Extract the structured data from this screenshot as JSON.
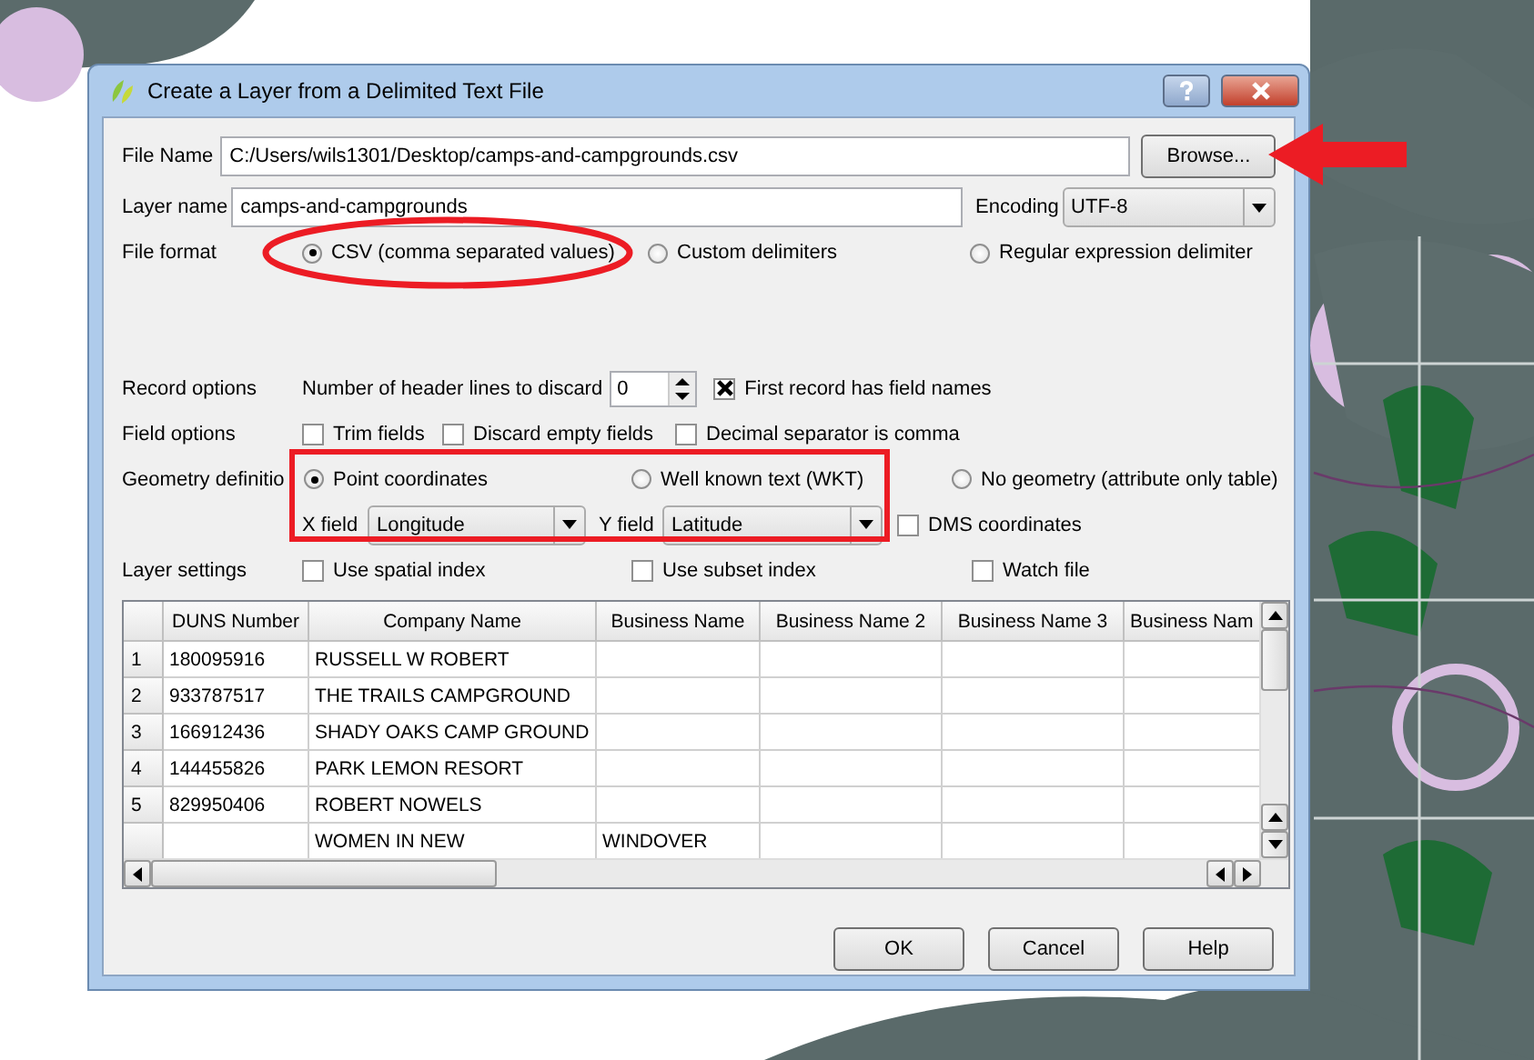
{
  "window": {
    "title": "Create a Layer from a Delimited Text File"
  },
  "file_name": {
    "label": "File Name",
    "value": "C:/Users/wils1301/Desktop/camps-and-campgrounds.csv",
    "button": "Browse..."
  },
  "layer_name": {
    "label": "Layer name",
    "value": "camps-and-campgrounds"
  },
  "encoding": {
    "label": "Encoding",
    "value": "UTF-8"
  },
  "file_format": {
    "label": "File format",
    "options": [
      {
        "label": "CSV (comma separated values)",
        "selected": true
      },
      {
        "label": "Custom delimiters",
        "selected": false
      },
      {
        "label": "Regular expression delimiter",
        "selected": false
      }
    ]
  },
  "record_options": {
    "label": "Record options",
    "header_lines_label": "Number of header lines to discard",
    "header_lines": "0",
    "first_record": {
      "label": "First record has field names",
      "checked": true
    }
  },
  "field_options": {
    "label": "Field options",
    "options": [
      {
        "label": "Trim fields",
        "checked": false
      },
      {
        "label": "Discard empty fields",
        "checked": false
      },
      {
        "label": "Decimal separator is comma",
        "checked": false
      }
    ]
  },
  "geometry": {
    "label": "Geometry definitio",
    "options": [
      {
        "label": "Point coordinates",
        "selected": true
      },
      {
        "label": "Well known text (WKT)",
        "selected": false
      },
      {
        "label": "No geometry (attribute only table)",
        "selected": false
      }
    ],
    "x_field": {
      "label": "X field",
      "value": "Longitude"
    },
    "y_field": {
      "label": "Y field",
      "value": "Latitude"
    },
    "dms": {
      "label": "DMS coordinates",
      "checked": false
    }
  },
  "layer_settings": {
    "label": "Layer settings",
    "options": [
      {
        "label": "Use spatial index",
        "checked": false
      },
      {
        "label": "Use subset index",
        "checked": false
      },
      {
        "label": "Watch file",
        "checked": false
      }
    ]
  },
  "table": {
    "columns": [
      "DUNS Number",
      "Company Name",
      "Business Name",
      "Business Name 2",
      "Business Name 3",
      "Business Nam"
    ],
    "rows": [
      {
        "header": "1",
        "cells": [
          "180095916",
          "RUSSELL W ROBERT",
          "",
          "",
          "",
          ""
        ]
      },
      {
        "header": "2",
        "cells": [
          "933787517",
          "THE TRAILS CAMPGROUND",
          "",
          "",
          "",
          ""
        ]
      },
      {
        "header": "3",
        "cells": [
          "166912436",
          "SHADY OAKS CAMP GROUND",
          "",
          "",
          "",
          ""
        ]
      },
      {
        "header": "4",
        "cells": [
          "144455826",
          "PARK LEMON RESORT",
          "",
          "",
          "",
          ""
        ]
      },
      {
        "header": "5",
        "cells": [
          "829950406",
          "ROBERT NOWELS",
          "",
          "",
          "",
          ""
        ]
      },
      {
        "header": "",
        "cells": [
          "",
          "WOMEN IN NEW",
          "WINDOVER",
          "",
          "",
          ""
        ]
      }
    ]
  },
  "buttons": [
    "OK",
    "Cancel",
    "Help"
  ]
}
